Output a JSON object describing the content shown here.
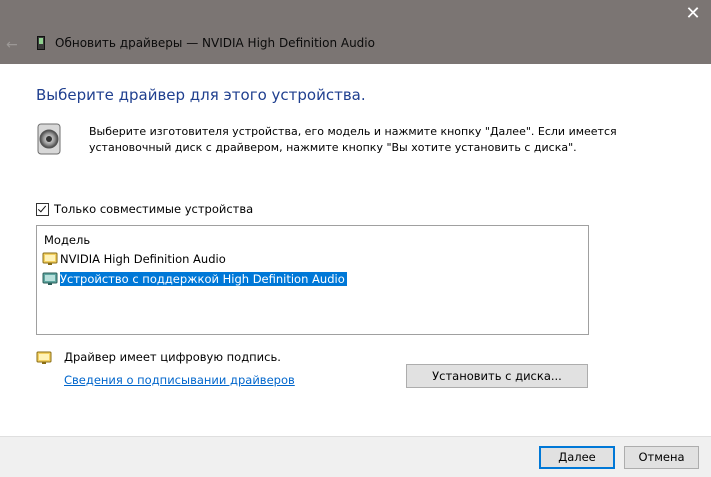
{
  "window": {
    "title": "Обновить драйверы — NVIDIA High Definition Audio",
    "close_glyph": "✕",
    "back_glyph": "←"
  },
  "page": {
    "heading": "Выберите драйвер для этого устройства.",
    "description_line1": "Выберите изготовителя устройства, его модель и нажмите кнопку \"Далее\". Если имеется",
    "description_line2": "установочный диск с  драйвером, нажмите кнопку \"Вы хотите установить с диска\"."
  },
  "compat_checkbox": {
    "label": "Только совместимые устройства",
    "checked": true
  },
  "model_list": {
    "header": "Модель",
    "items": [
      {
        "label": "NVIDIA High Definition Audio",
        "selected": false,
        "icon": "driver-icon"
      },
      {
        "label": "Устройство с поддержкой High Definition Audio",
        "selected": true,
        "icon": "driver-icon"
      }
    ]
  },
  "signature": {
    "status_text": "Драйвер имеет цифровую подпись.",
    "link_text": "Сведения о подписывании драйверов",
    "icon": "signed-driver-icon"
  },
  "buttons": {
    "have_disk": "Установить с диска...",
    "next": "Далее",
    "cancel": "Отмена"
  },
  "colors": {
    "titlebar_bg": "#7b7573",
    "heading": "#1f3f8f",
    "selection": "#0078d7",
    "link": "#0066cc",
    "footer_bg": "#f0f0f0"
  }
}
